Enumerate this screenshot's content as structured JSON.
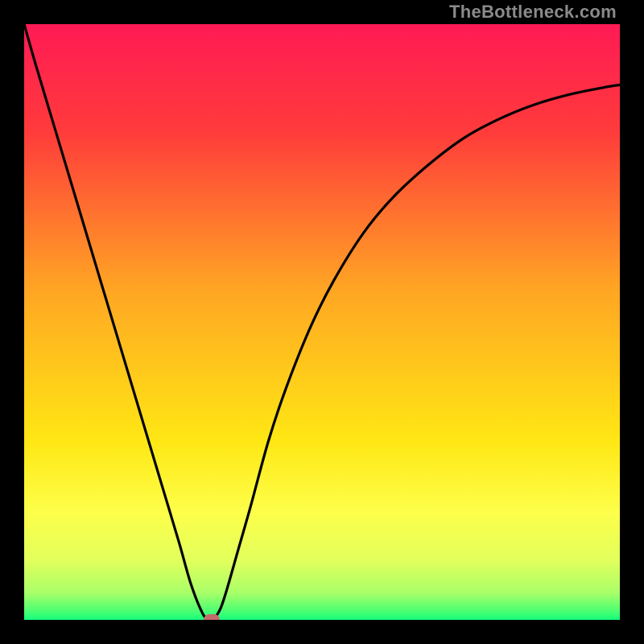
{
  "watermark": "TheBottleneck.com",
  "chart_data": {
    "type": "line",
    "title": "",
    "xlabel": "",
    "ylabel": "",
    "xlim": [
      0,
      100
    ],
    "ylim": [
      0,
      100
    ],
    "x": [
      0,
      2,
      5,
      8,
      11,
      14,
      17,
      20,
      23,
      26,
      28,
      30,
      31,
      31.5,
      32,
      33,
      34,
      36,
      38,
      41,
      44,
      48,
      52,
      57,
      62,
      68,
      74,
      80,
      86,
      92,
      98,
      100
    ],
    "values": [
      100,
      93,
      83,
      73,
      63,
      53,
      43,
      33,
      23,
      13,
      6,
      1,
      0.2,
      0,
      0.3,
      2,
      5,
      12,
      19,
      30,
      39,
      49,
      57,
      65,
      71,
      76.5,
      81,
      84.2,
      86.6,
      88.3,
      89.5,
      89.8
    ],
    "marker": {
      "x": 31.5,
      "y": 0
    },
    "gradient_stops": [
      {
        "pos": 0,
        "color": "#ff1a55"
      },
      {
        "pos": 0.18,
        "color": "#ff3b3b"
      },
      {
        "pos": 0.45,
        "color": "#ffa723"
      },
      {
        "pos": 0.7,
        "color": "#ffe714"
      },
      {
        "pos": 0.82,
        "color": "#fdff4a"
      },
      {
        "pos": 0.9,
        "color": "#e2ff5c"
      },
      {
        "pos": 0.955,
        "color": "#a8ff68"
      },
      {
        "pos": 0.985,
        "color": "#4cff72"
      },
      {
        "pos": 1.0,
        "color": "#15ff7c"
      }
    ]
  }
}
